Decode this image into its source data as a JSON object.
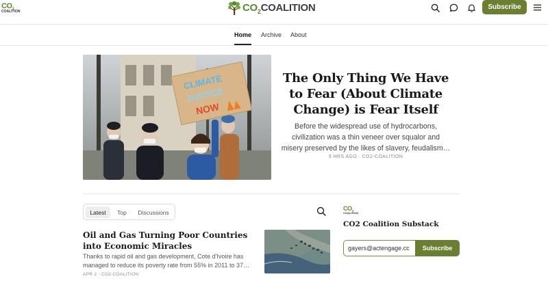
{
  "header": {
    "mini_logo_mark": "CO",
    "mini_logo_sub": "2",
    "mini_logo_caption": "COALITION",
    "brand_co": "CO",
    "brand_sub": "2",
    "brand_rest": "COALITION",
    "subscribe_label": "Subscribe",
    "icons": [
      "search-icon",
      "chat-icon",
      "bell-icon",
      "menu-icon"
    ],
    "accent_color": "#6b7f32"
  },
  "nav": {
    "items": [
      {
        "label": "Home",
        "active": true
      },
      {
        "label": "Archive",
        "active": false
      },
      {
        "label": "About",
        "active": false
      }
    ]
  },
  "hero": {
    "sign_lines": [
      "CLIMATE",
      "JUSTICE",
      "NOW"
    ],
    "title": "The Only Thing We Have to Fear (About Climate Change) is Fear Itself",
    "excerpt": "Before the widespread use of hydrocarbons, civilization was a thin veneer over squalor and misery preserved by the likes of slavery, feudalism…",
    "meta": "9 HRS AGO · CO2-COALITION"
  },
  "feed": {
    "tabs": [
      {
        "label": "Latest",
        "active": true
      },
      {
        "label": "Top",
        "active": false
      },
      {
        "label": "Discussions",
        "active": false
      }
    ],
    "posts": [
      {
        "title": "Oil and Gas Turning Poor Countries into Economic Miracles",
        "excerpt_line1": "Thanks to rapid oil and gas development, Cote d'Ivoire has",
        "excerpt_line2": "managed to reduce its poverty rate from 55% in 2011 to 37…",
        "meta": "APR 2 · CO2-COALITION"
      }
    ]
  },
  "sidebar": {
    "logo_mark": "CO",
    "logo_sub": "2",
    "logo_caption": "COALITION",
    "title": "CO2 Coalition Substack",
    "email_value": "gayers@actengage.cc",
    "subscribe_label": "Subscribe"
  }
}
